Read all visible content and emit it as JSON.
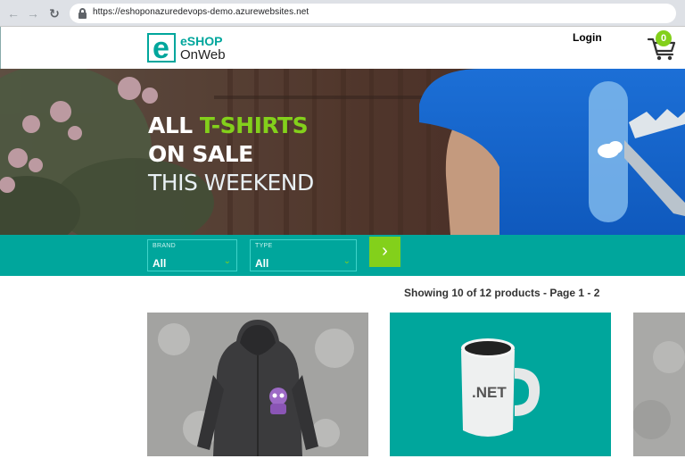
{
  "browser": {
    "url": "https://eshoponazuredevops-demo.azurewebsites.net",
    "icons": [
      "back-arrow-icon",
      "forward-arrow-icon",
      "reload-icon",
      "lock-icon"
    ]
  },
  "header": {
    "logo": {
      "letter": "e",
      "line1": "eSHOP",
      "line2": "OnWeb"
    },
    "login_label": "Login",
    "cart_count": "0"
  },
  "hero": {
    "line1_prefix": "ALL ",
    "line1_accent": "T-SHIRTS",
    "line2": "ON SALE",
    "line3": "THIS WEEKEND"
  },
  "filters": {
    "brand": {
      "label": "BRAND",
      "value": "All"
    },
    "type": {
      "label": "TYPE",
      "value": "All"
    },
    "apply_icon": "chevron-right-icon"
  },
  "pager": {
    "text": "Showing 10 of 12 products - Page 1 - 2"
  },
  "products": [
    {
      "image": "dark-hoodie-with-purple-robot"
    },
    {
      "image": "white-net-mug-on-teal",
      "mug_text": ".NET"
    },
    {
      "image": "partial-product-gray"
    }
  ],
  "colors": {
    "brand_teal": "#00a69c",
    "accent_green": "#83d01b"
  }
}
